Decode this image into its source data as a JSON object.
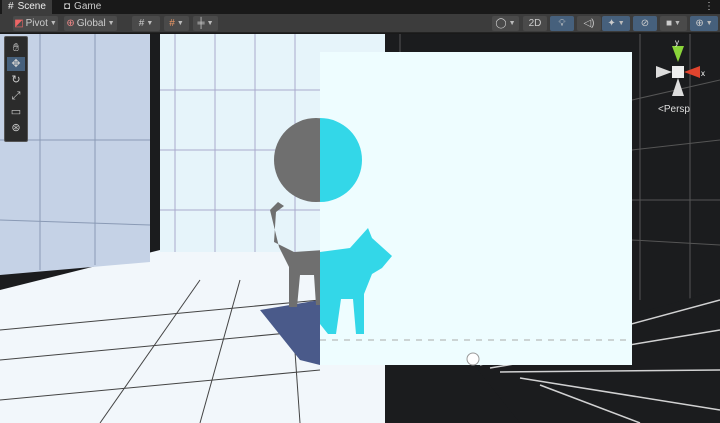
{
  "tabs": [
    {
      "label": "Scene",
      "icon": "grid-icon",
      "active": true
    },
    {
      "label": "Game",
      "icon": "gamepad-icon",
      "active": false
    }
  ],
  "toolbar": {
    "pivot_label": "Pivot",
    "global_label": "Global",
    "mode_2d_label": "2D",
    "left_icons": [
      "grid-snap-icon",
      "increment-snap-icon",
      "ruler-icon"
    ],
    "right_icons": [
      "draw-mode-icon",
      "lighting-icon",
      "audio-icon",
      "effects-icon",
      "visibility-icon",
      "camera-icon",
      "gizmos-icon"
    ]
  },
  "tools": [
    "view-tool",
    "move-tool",
    "rotate-tool",
    "scale-tool",
    "rect-tool",
    "transform-tool"
  ],
  "gizmo": {
    "y_label": "y",
    "x_label": "x",
    "projection_label": "Persp"
  },
  "colors": {
    "accent": "#46607c",
    "cyan": "#33d7e8",
    "x_axis": "#e0442e",
    "y_axis": "#8ad43a"
  }
}
